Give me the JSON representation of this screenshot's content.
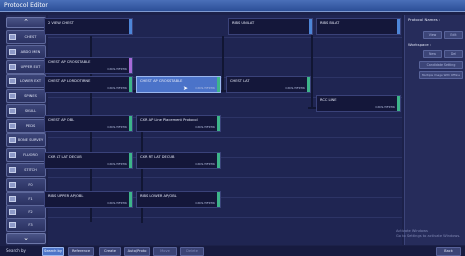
{
  "window": {
    "title": "Protocol Editor"
  },
  "sidebar": {
    "items": [
      {
        "label": "CHEST"
      },
      {
        "label": "ABDO MEN"
      },
      {
        "label": "UPPER EXT"
      },
      {
        "label": "LOWER EXT"
      },
      {
        "label": "SPINES"
      },
      {
        "label": "SKULL"
      },
      {
        "label": "PEDS"
      },
      {
        "label": "BONE SURVEY"
      },
      {
        "label": "FLUORO"
      },
      {
        "label": "STITCH"
      },
      {
        "label": "F0"
      },
      {
        "label": "F1"
      },
      {
        "label": "F2"
      },
      {
        "label": "F3"
      },
      {
        "label": "F4"
      },
      {
        "label": "F5"
      }
    ]
  },
  "cards": [
    {
      "name": "2 VIEW CHEST",
      "code": "",
      "tick": "#4d86d8"
    },
    {
      "name": "RIBS UNILAT",
      "code": "",
      "tick": "#4d86d8"
    },
    {
      "name": "RIBS BILAT",
      "code": "",
      "tick": "#4d86d8"
    },
    {
      "name": "CHEST AP CROSSTABLE",
      "code": "CXCS-TIFKTIK",
      "tick": "#a76ad8"
    },
    {
      "name": "CHEST AP LORDOTIRNE",
      "code": "CXCS-TIFKTIK",
      "tick": "#3db58a"
    },
    {
      "name": "CHEST AP CROSSTABLE",
      "code": "CXCS-TIFKTIK",
      "tick": "#3db58a"
    },
    {
      "name": "CHEST LAT",
      "code": "CXCS-TIFKTIK",
      "tick": "#3db58a"
    },
    {
      "name": "RCC LINE",
      "code": "CXCS-TIFKTIK",
      "tick": "#3db58a"
    },
    {
      "name": "CHEST AP OBL",
      "code": "CXCS-TIFKTIK",
      "tick": "#3db58a"
    },
    {
      "name": "CXR AP Line Placement Protocol",
      "code": "CXCS-TIFKTIK",
      "tick": "#3db58a"
    },
    {
      "name": "CXR LT LAT DECUB",
      "code": "CXCS-TIFKTIK",
      "tick": "#3db58a"
    },
    {
      "name": "CXR RT LAT DECUB",
      "code": "CXCS-TIFKTIK",
      "tick": "#3db58a"
    },
    {
      "name": "RIBS UPPER AP/OBL",
      "code": "CXCS-TIFKTIK",
      "tick": "#3db58a"
    },
    {
      "name": "RIBS LOWER AP/OBL",
      "code": "CXCS-TIFKTIK",
      "tick": "#3db58a"
    }
  ],
  "right_panel": {
    "protocol_names_label": "Protocol Names :",
    "view_label": "View",
    "edit_label": "Edit",
    "workspace_label": "Workspace :",
    "new_label": "New",
    "del_label": "Del",
    "candidate_setting_label": "Candidate Setting",
    "multiple_image_label": "Multiple Image With Offline"
  },
  "watermark": {
    "line1": "Activate Windows",
    "line2": "Go to Settings to activate Windows."
  },
  "toolbar": {
    "search_by_label": "Search by",
    "buttons": [
      {
        "label": "Search by"
      },
      {
        "label": "Reference"
      },
      {
        "label": "Create"
      },
      {
        "label": "Auto/Proto"
      },
      {
        "label": "Move"
      },
      {
        "label": "Delete"
      },
      {
        "label": "Back"
      }
    ]
  }
}
